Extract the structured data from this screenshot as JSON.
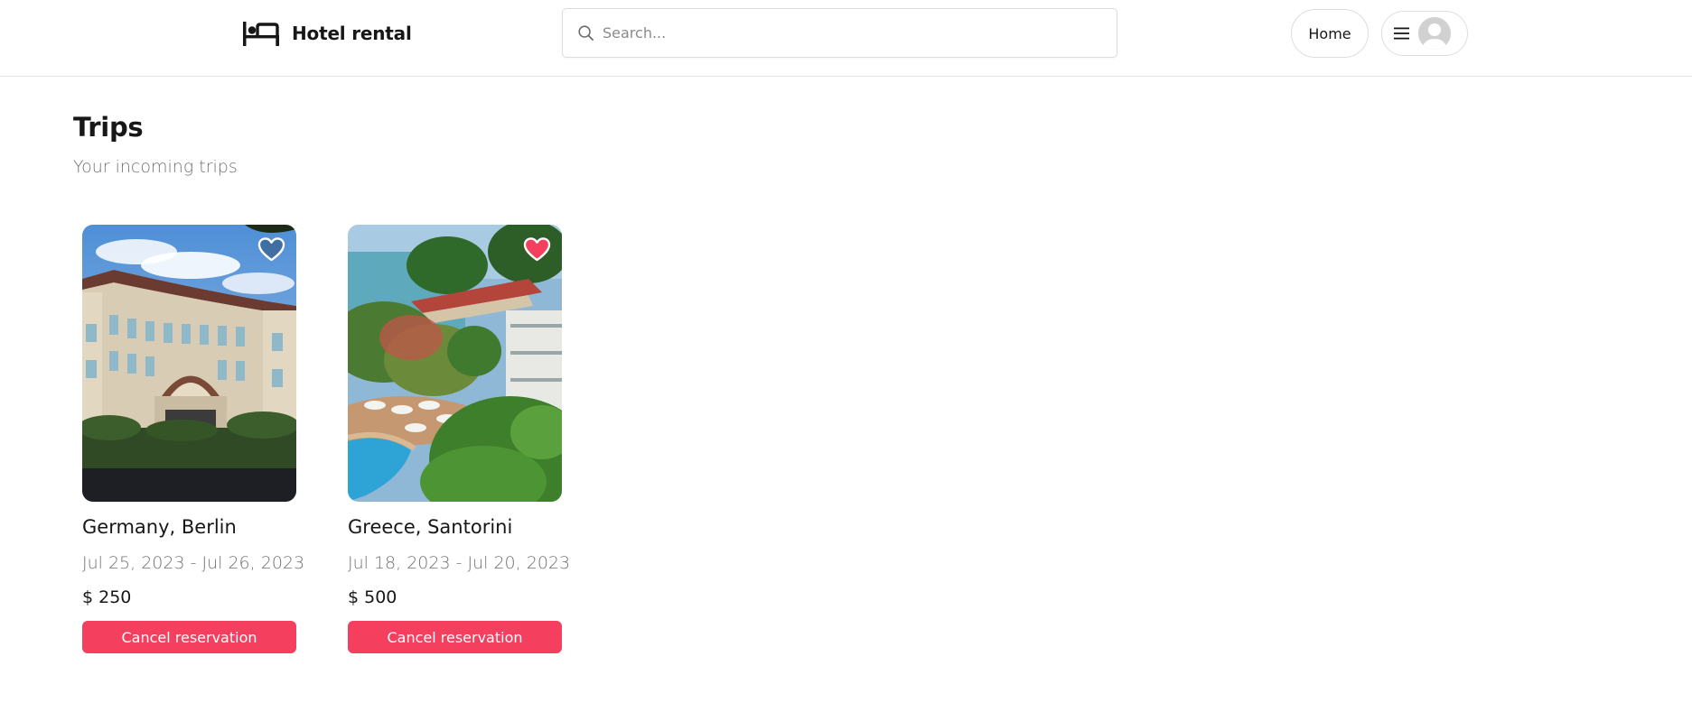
{
  "navbar": {
    "logo_text": "Hotel rental",
    "logo_icon": "bed-icon",
    "search_placeholder": "Search...",
    "search_value": "",
    "home_label": "Home",
    "menu_icon": "hamburger-icon",
    "avatar_icon": "user-avatar-placeholder"
  },
  "page": {
    "title": "Trips",
    "subtitle": "Your incoming trips"
  },
  "trips": [
    {
      "location": "Germany, Berlin",
      "dates": "Jul 25, 2023 - Jul 26, 2023",
      "price": "$ 250",
      "favorited": false,
      "cancel_label": "Cancel reservation"
    },
    {
      "location": "Greece, Santorini",
      "dates": "Jul 18, 2023 - Jul 20, 2023",
      "price": "$ 500",
      "favorited": true,
      "cancel_label": "Cancel reservation"
    }
  ],
  "colors": {
    "accent": "#f43f5e",
    "heart_active": "#f43f5e",
    "muted_text": "#737373",
    "border": "#e5e5e5"
  }
}
